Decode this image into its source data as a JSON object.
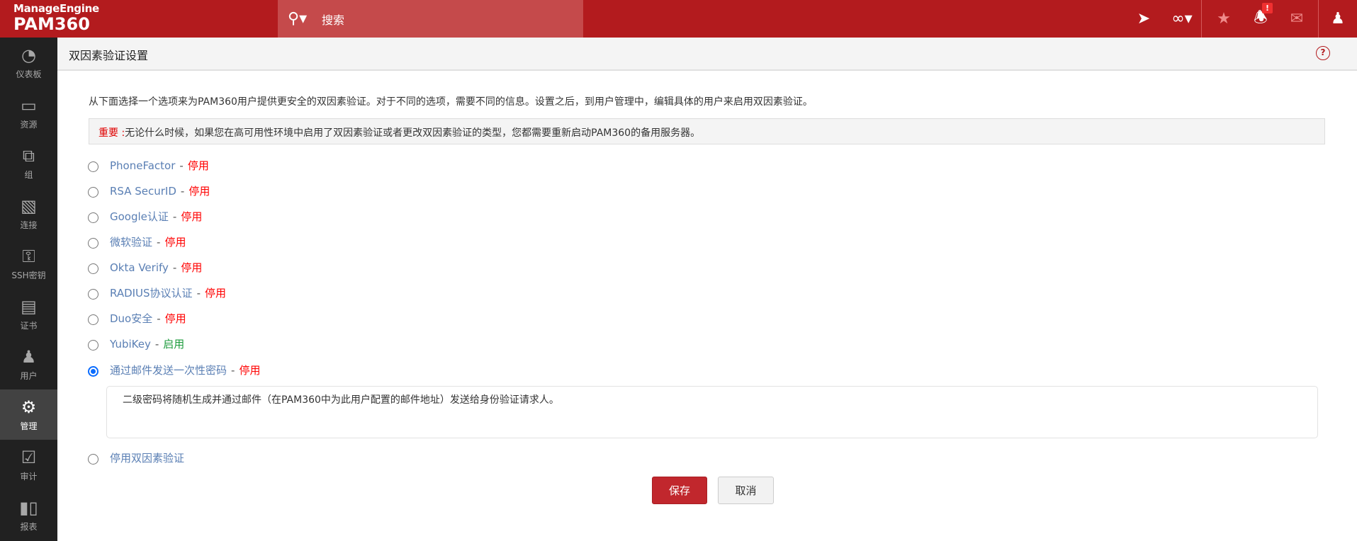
{
  "header": {
    "brand": "ManageEngine",
    "product": "PAM360",
    "search_label": "搜索",
    "notification_badge": "!"
  },
  "sidebar": {
    "items": [
      {
        "label": "仪表板",
        "icon": "dashboard-icon"
      },
      {
        "label": "资源",
        "icon": "monitor-icon"
      },
      {
        "label": "组",
        "icon": "group-icon"
      },
      {
        "label": "连接",
        "icon": "connection-icon"
      },
      {
        "label": "SSH密钥",
        "icon": "key-icon"
      },
      {
        "label": "证书",
        "icon": "certificate-icon"
      },
      {
        "label": "用户",
        "icon": "user-icon"
      },
      {
        "label": "管理",
        "icon": "gear-icon",
        "active": true
      },
      {
        "label": "审计",
        "icon": "clipboard-icon"
      },
      {
        "label": "报表",
        "icon": "bar-chart-icon"
      }
    ]
  },
  "page": {
    "title": "双因素验证设置",
    "description": "从下面选择一个选项来为PAM360用户提供更安全的双因素验证。对于不同的选项，需要不同的信息。设置之后，到用户管理中，编辑具体的用户来启用双因素验证。",
    "note_label": "重要 :",
    "note_text": "无论什么时候，如果您在高可用性环境中启用了双因素验证或者更改双因素验证的类型，您都需要重新启动PAM360的备用服务器。",
    "options": [
      {
        "name": "PhoneFactor",
        "status": "停用"
      },
      {
        "name": "RSA SecurID",
        "status": "停用"
      },
      {
        "name": "Google认证",
        "status": "停用"
      },
      {
        "name": "微软验证",
        "status": "停用"
      },
      {
        "name": "Okta Verify",
        "status": "停用"
      },
      {
        "name": "RADIUS协议认证",
        "status": "停用"
      },
      {
        "name": "Duo安全",
        "status": "停用"
      },
      {
        "name": "YubiKey",
        "status": "启用"
      },
      {
        "name": "通过邮件发送一次性密码",
        "status": "停用",
        "selected": true
      }
    ],
    "email_info": "二级密码将随机生成并通过邮件（在PAM360中为此用户配置的邮件地址）发送给身份验证请求人。",
    "disable_option": "停用双因素验证",
    "dash": "-",
    "save_label": "保存",
    "cancel_label": "取消"
  },
  "colors": {
    "brand": "#b31b1e",
    "disabled": "#ff0000",
    "enabled": "#1a9a3a"
  }
}
